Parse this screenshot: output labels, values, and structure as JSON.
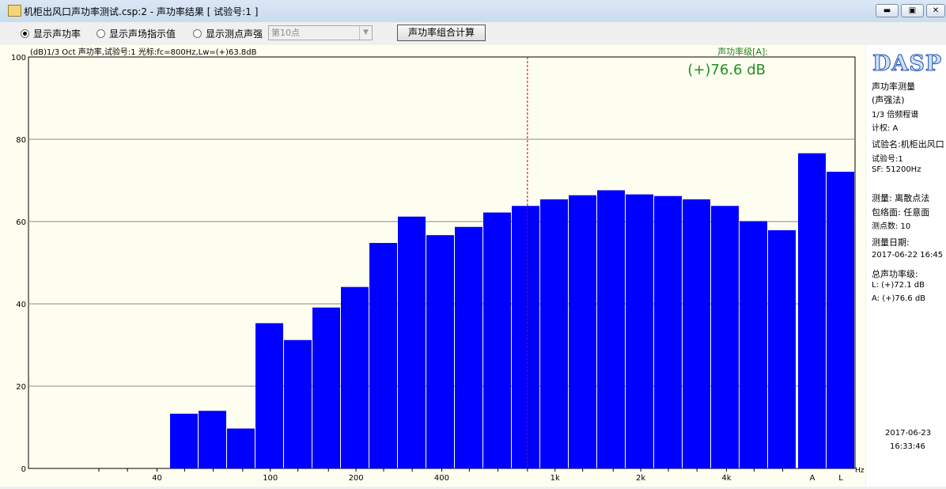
{
  "window": {
    "title": "机柜出风口声功率测试.csp:2 - 声功率结果 [ 试验号:1 ]",
    "buttons": [
      "▬",
      "▣",
      "✕"
    ]
  },
  "toolbar": {
    "radios": [
      {
        "label": "显示声功率",
        "selected": true
      },
      {
        "label": "显示声场指示值",
        "selected": false
      },
      {
        "label": "显示测点声强",
        "selected": false
      }
    ],
    "point_select": "第10点",
    "calc_button": "声功率组合计算"
  },
  "plot": {
    "header": "(dB)1/3 Oct 声功率,试验号:1 光标:fc=800Hz,Lw=(+)63.8dB",
    "level_label": "声功率级[A]:",
    "level_value": "(+)76.6 dB",
    "unit": "Hz",
    "cursor_band": "800"
  },
  "chart_data": {
    "type": "bar",
    "ylim": [
      0,
      100
    ],
    "y_ticks": [
      "0",
      "20",
      "40",
      "60",
      "80",
      "100"
    ],
    "x_scale": "log",
    "x_tick_labels": [
      {
        "label": "40",
        "hz": 40
      },
      {
        "label": "100",
        "hz": 100
      },
      {
        "label": "200",
        "hz": 200
      },
      {
        "label": "400",
        "hz": 400
      },
      {
        "label": "1k",
        "hz": 1000
      },
      {
        "label": "2k",
        "hz": 2000
      },
      {
        "label": "4k",
        "hz": 4000
      }
    ],
    "categories": [
      "25",
      "31.5",
      "40",
      "50",
      "63",
      "80",
      "100",
      "125",
      "160",
      "200",
      "250",
      "315",
      "400",
      "500",
      "630",
      "800",
      "1000",
      "1250",
      "1600",
      "2000",
      "2500",
      "3150",
      "4000",
      "5000",
      "6300"
    ],
    "values": [
      0,
      0,
      0,
      13.3,
      14.0,
      9.7,
      35.3,
      31.2,
      39.1,
      44.1,
      54.8,
      61.2,
      56.7,
      58.7,
      62.2,
      63.8,
      65.4,
      66.4,
      67.6,
      66.6,
      66.2,
      65.4,
      63.8,
      60.1,
      57.9
    ],
    "totals": [
      {
        "label": "A",
        "value": 76.6
      },
      {
        "label": "L",
        "value": 72.1
      }
    ],
    "grid": true,
    "bar_color": "#0000ff"
  },
  "sidebar": {
    "logo": "DASP",
    "lines": [
      "声功率测量",
      "(声强法)",
      "1/3 倍频程谱",
      "计权: A",
      "试验名:机柜出风口",
      "试验号:1",
      "SF: 51200Hz",
      "测量: 离散点法",
      "包络面: 任意面",
      "测点数: 10",
      "测量日期:",
      "2017-06-22 16:45",
      "总声功率级:",
      "L:  (+)72.1 dB",
      "A:  (+)76.6 dB"
    ],
    "date": "2017-06-23",
    "time": "16:33:46"
  }
}
